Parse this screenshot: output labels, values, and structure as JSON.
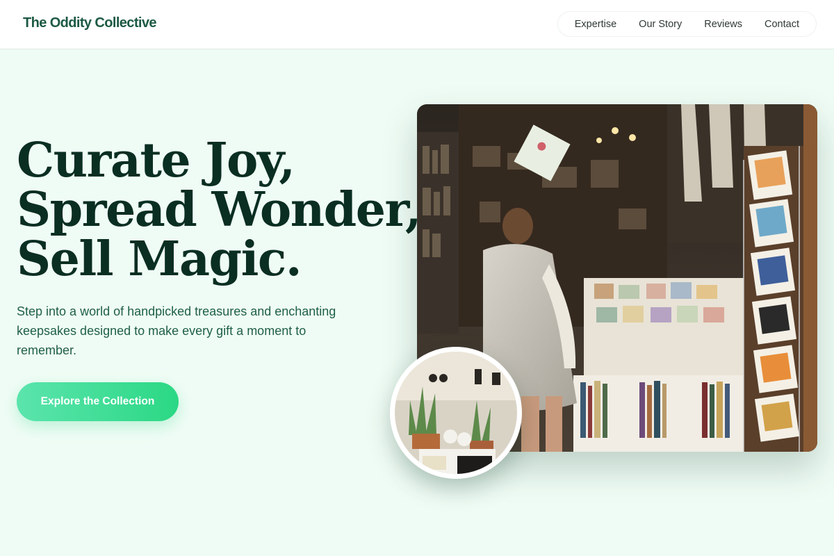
{
  "header": {
    "brand": "The Oddity Collective",
    "nav": [
      {
        "label": "Expertise"
      },
      {
        "label": "Our Story"
      },
      {
        "label": "Reviews"
      },
      {
        "label": "Contact"
      }
    ]
  },
  "hero": {
    "headline_lines": [
      "Curate Joy,",
      "Spread Wonder,",
      "Sell Magic."
    ],
    "subtext": "Step into a world of handpicked treasures and enchanting keepsakes designed to make every gift a moment to remember.",
    "cta_label": "Explore the Collection"
  },
  "colors": {
    "page_background": "#effcf5",
    "brand": "#1d5a43",
    "headline": "#0a2e22",
    "subtext": "#1f5f47",
    "cta_gradient_start": "#5be4ad",
    "cta_gradient_end": "#2bd884"
  },
  "images": {
    "main": "shop-interior-photo",
    "inset": "plants-and-trinkets-photo"
  }
}
